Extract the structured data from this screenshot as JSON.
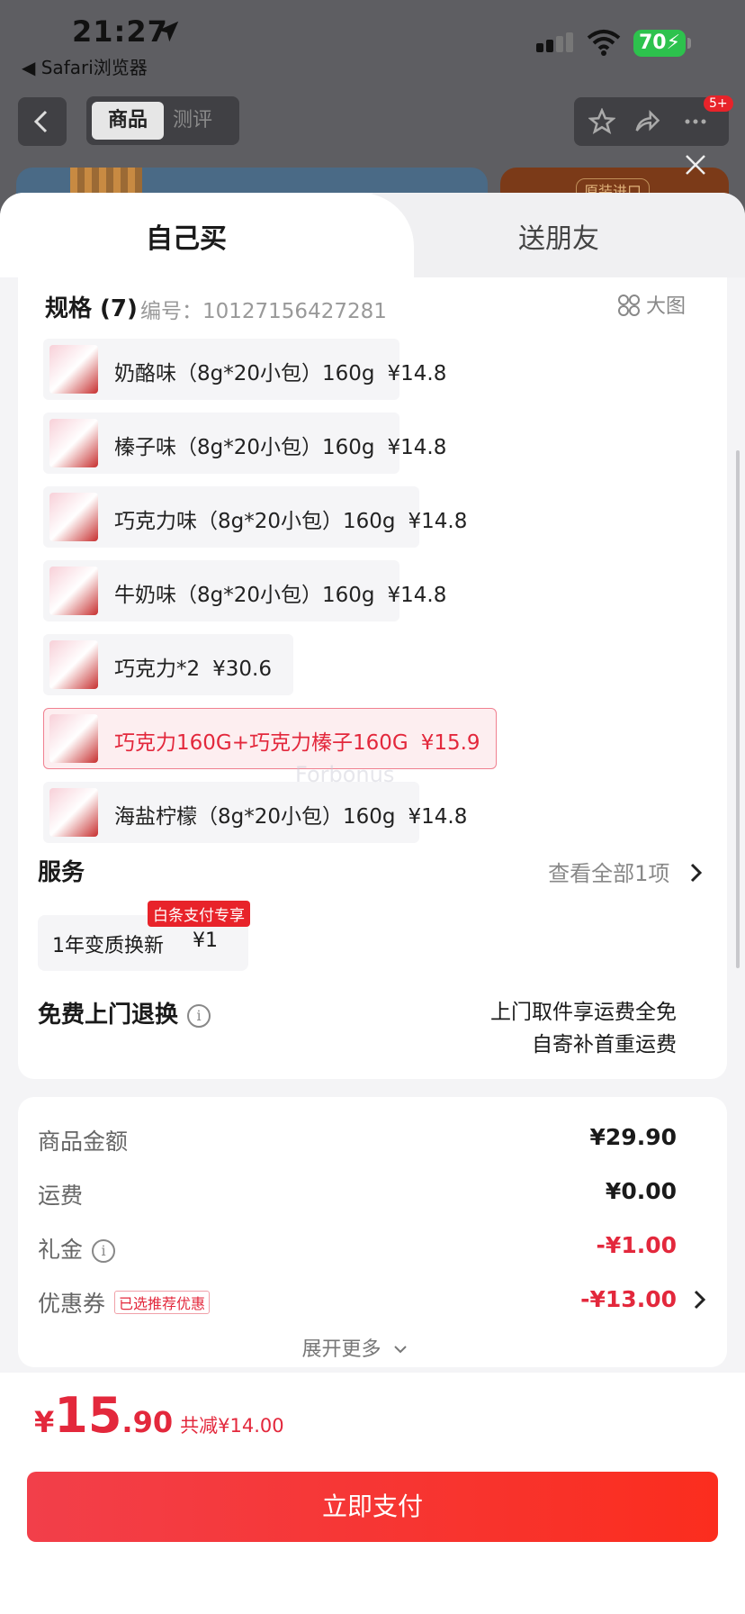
{
  "status_bar": {
    "time": "21:27",
    "back_app": "◀ Safari浏览器",
    "battery": "70"
  },
  "nav": {
    "tab_active": "商品",
    "tab_other": "测评",
    "badge": "5+"
  },
  "background_banner": {
    "tag": "原装进口"
  },
  "sheet_tabs": {
    "self": "自己买",
    "friend": "送朋友"
  },
  "spec": {
    "heading": "规格 (7)",
    "code": "编号：10127156427281",
    "big_pic": "大图",
    "items": [
      {
        "name": "奶酪味（8g*20小包）160g",
        "price": "¥14.8",
        "selected": false
      },
      {
        "name": "榛子味（8g*20小包）160g",
        "price": "¥14.8",
        "selected": false
      },
      {
        "name": "巧克力味（8g*20小包）160g",
        "price": "¥14.8",
        "selected": false
      },
      {
        "name": "牛奶味（8g*20小包）160g",
        "price": "¥14.8",
        "selected": false
      },
      {
        "name": "巧克力*2",
        "price": "¥30.6",
        "selected": false
      },
      {
        "name": "巧克力160G+巧克力榛子160G",
        "price": "¥15.9",
        "selected": true
      },
      {
        "name": "海盐柠檬（8g*20小包）160g",
        "price": "¥14.8",
        "selected": false
      }
    ]
  },
  "watermark": "Forbonus",
  "service": {
    "title": "服务",
    "view_all": "查看全部1项",
    "card_title": "1年变质换新",
    "card_price": "¥1",
    "tag": "白条支付专享"
  },
  "free_return": {
    "title": "免费上门退换",
    "line1": "上门取件享运费全免",
    "line2": "自寄补首重运费"
  },
  "summary": {
    "goods_label": "商品金额",
    "goods_value": "¥29.90",
    "shipping_label": "运费",
    "shipping_value": "¥0.00",
    "gift_label": "礼金",
    "gift_value": "-¥1.00",
    "coupon_label": "优惠券",
    "coupon_tag": "已选推荐优惠",
    "coupon_value": "-¥13.00",
    "expand": "展开更多"
  },
  "footer": {
    "currency": "¥",
    "total_int": "15",
    "total_dec": ".90",
    "saved": "共减¥14.00",
    "pay_button": "立即支付"
  },
  "colors": {
    "accent_red": "#e3283c",
    "battery_green": "#2dc24d"
  }
}
